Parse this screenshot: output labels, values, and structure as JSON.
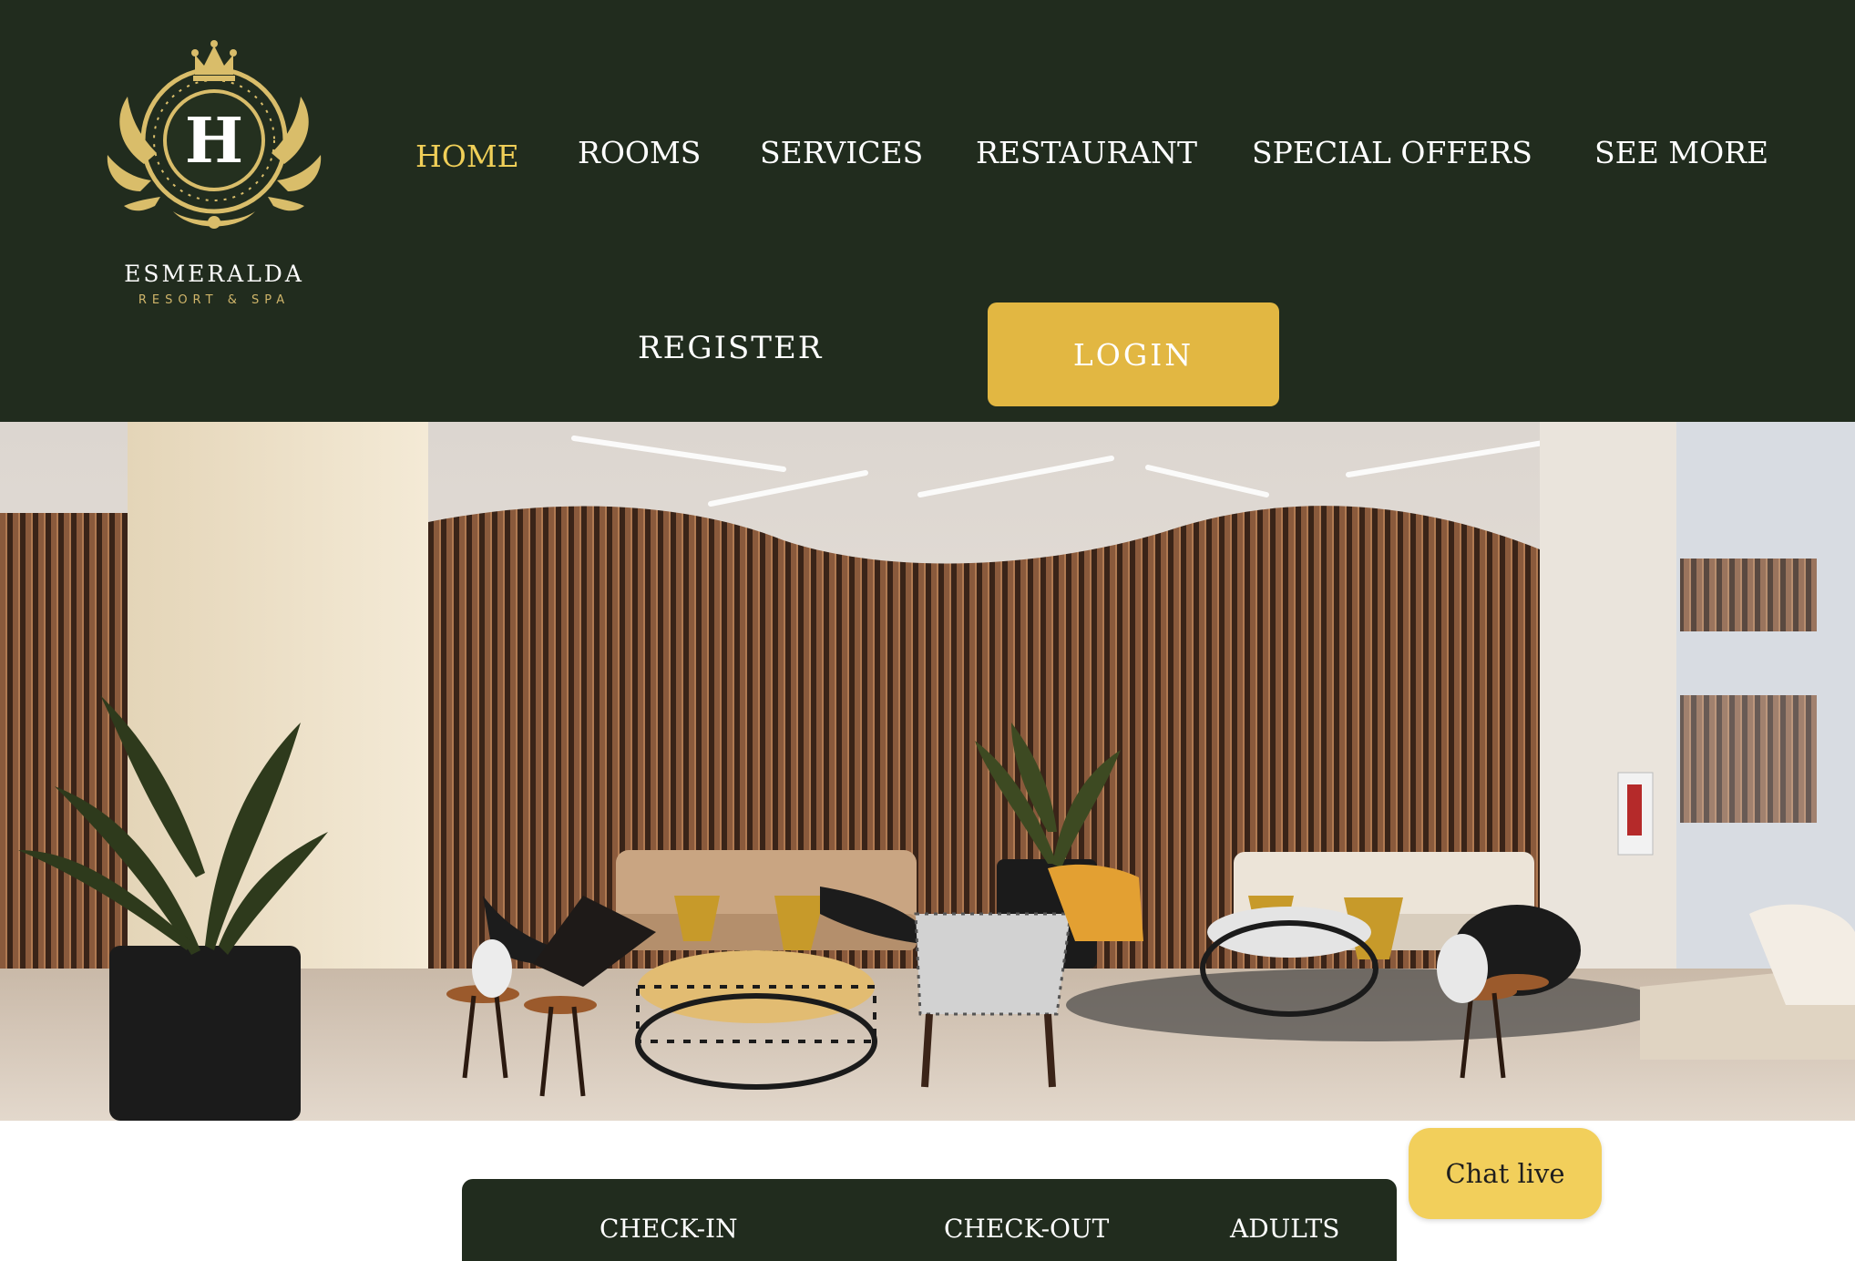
{
  "brand": {
    "monogram": "H",
    "name": "ESMERALDA",
    "tagline": "RESORT & SPA"
  },
  "nav": {
    "items": [
      {
        "label": "HOME",
        "active": true
      },
      {
        "label": "ROOMS",
        "active": false
      },
      {
        "label": "SERVICES",
        "active": false
      },
      {
        "label": "RESTAURANT",
        "active": false
      },
      {
        "label": "SPECIAL OFFERS",
        "active": false
      },
      {
        "label": "SEE MORE",
        "active": false
      }
    ],
    "register_label": "REGISTER",
    "login_label": "LOGIN"
  },
  "booking": {
    "fields": [
      "CHECK-IN",
      "CHECK-OUT",
      "ADULTS"
    ]
  },
  "chat": {
    "label": "Chat live"
  },
  "colors": {
    "header_bg": "#212c1e",
    "accent_gold": "#e2b742",
    "active_nav": "#f0cf58",
    "chat_bg": "#f2cf5b"
  }
}
